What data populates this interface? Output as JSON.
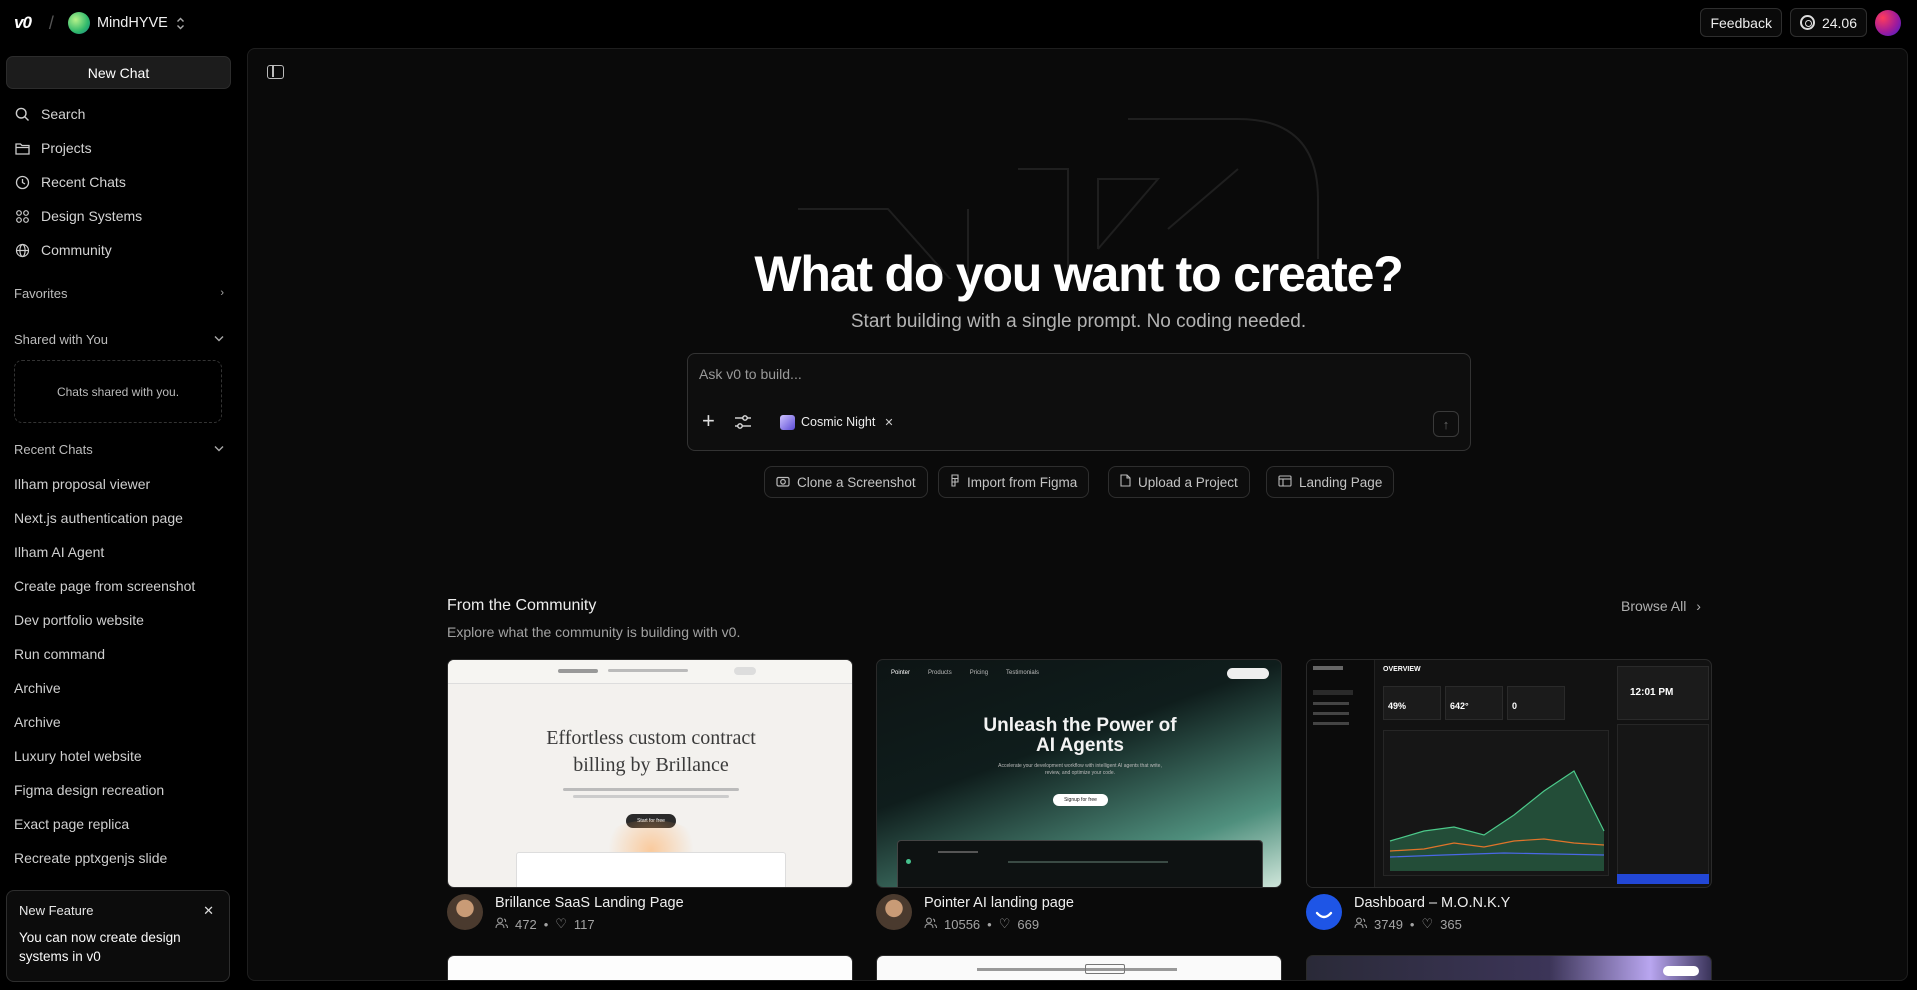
{
  "topbar": {
    "logo": "v0",
    "workspace": "MindHYVE",
    "feedback": "Feedback",
    "credits": "24.06"
  },
  "sidebar": {
    "new_chat": "New Chat",
    "nav": [
      "Search",
      "Projects",
      "Recent Chats",
      "Design Systems",
      "Community"
    ],
    "favorites": "Favorites",
    "shared_with_you": "Shared with You",
    "shared_empty": "Chats shared with you.",
    "recent_chats_title": "Recent Chats",
    "recent": [
      "Ilham proposal viewer",
      "Next.js authentication page",
      "Ilham AI Agent",
      "Create page from screenshot",
      "Dev portfolio website",
      "Run command",
      "Archive",
      "Archive",
      "Luxury hotel website",
      "Figma design recreation",
      "Exact page replica",
      "Recreate pptxgenjs slide"
    ],
    "feature": {
      "title": "New Feature",
      "body": "You can now create design systems in v0"
    }
  },
  "main": {
    "title": "What do you want to create?",
    "subtitle": "Start building with a single prompt. No coding needed.",
    "prompt_placeholder": "Ask v0 to build...",
    "chip": "Cosmic Night",
    "quick_actions": [
      "Clone a Screenshot",
      "Import from Figma",
      "Upload a Project",
      "Landing Page"
    ],
    "community_title": "From the Community",
    "community_sub": "Explore what the community is building with v0.",
    "browse_all": "Browse All",
    "cards": [
      {
        "title": "Brillance SaaS Landing Page",
        "views": "472",
        "likes": "117",
        "thumb_heading": "Effortless custom contract billing by Brillance",
        "thumb_button": "Start for free"
      },
      {
        "title": "Pointer AI landing page",
        "views": "10556",
        "likes": "669",
        "thumb_heading": "Unleash the Power of AI Agents",
        "thumb_sub": "Accelerate your development workflow with intelligent AI agents that write, review, and optimize your code.",
        "thumb_button": "Signup for free",
        "thumb_nav": [
          "Pointer",
          "Products",
          "Pricing",
          "Testimonials"
        ]
      },
      {
        "title": "Dashboard – M.O.N.K.Y",
        "views": "3749",
        "likes": "365",
        "thumb_header": "OVERVIEW",
        "thumb_time": "12:01 PM",
        "thumb_stats": [
          "49%",
          "642°",
          "0"
        ]
      }
    ]
  },
  "colors": {
    "background": "#000000",
    "panel": "#0a0a0a",
    "border": "#2e2e2e",
    "text": "#ededed",
    "muted": "#a2a2a2"
  }
}
